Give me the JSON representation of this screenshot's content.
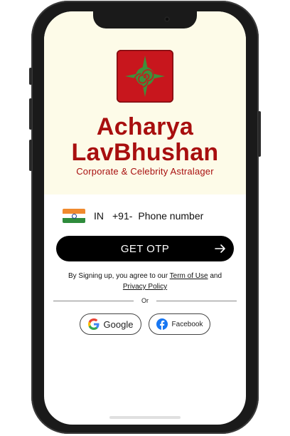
{
  "brand": {
    "line1": "Acharya",
    "line2": "LavBhushan",
    "tagline": "Corporate & Celebrity Astralager",
    "primary_color": "#a80f0f",
    "logo_bg": "#c8161d"
  },
  "phone_entry": {
    "flag_icon": "india-flag-icon",
    "country_code": "IN",
    "dial_code": "+91-",
    "placeholder": "Phone number",
    "value": ""
  },
  "otp_button": {
    "label": "GET OTP",
    "icon": "arrow-right-icon"
  },
  "terms": {
    "prefix": "By Signing up, you agree to our",
    "terms_link": "Term of Use",
    "and": "and",
    "privacy_link": "Privacy Policy"
  },
  "divider_text": "Or",
  "social": {
    "google_label": "Google",
    "facebook_label": "Facebook"
  }
}
